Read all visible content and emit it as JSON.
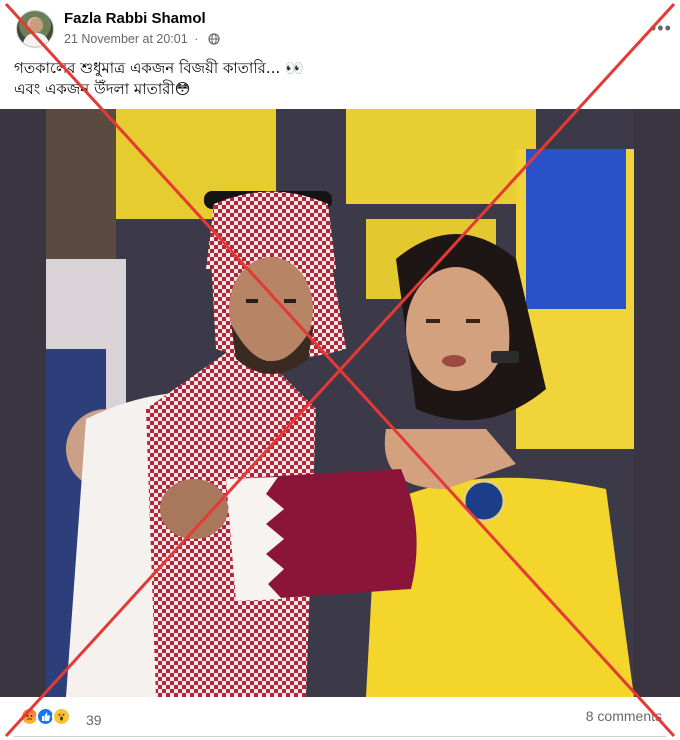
{
  "post": {
    "author": "Fazla Rabbi Shamol",
    "timestamp": "21 November at 20:01",
    "caption_line1": "গতকালের শুধুমাত্র  একজন বিজয়ী কাতারি... 👀",
    "caption_line2": "এবং একজন উঁদলা মাতারী😳"
  },
  "photo": {
    "description_icon": "photo"
  },
  "footer": {
    "reactions_count": "39",
    "comments": "8 comments"
  },
  "icons": {
    "globe": "globe-icon",
    "more": "more-options-icon",
    "reactions": [
      "angry-reaction-icon",
      "like-reaction-icon",
      "wow-reaction-icon"
    ]
  },
  "colors": {
    "cross_red": "#e53935",
    "meta_gray": "#65676b",
    "like_blue": "#1877f2"
  }
}
